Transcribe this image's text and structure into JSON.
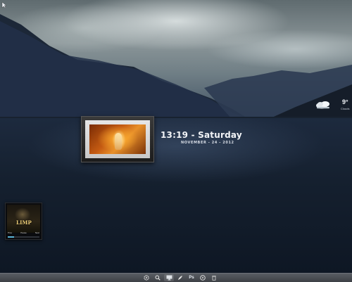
{
  "window": {
    "title": ""
  },
  "corner": {
    "icon": "arrow-cursor-icon"
  },
  "photo_widget": {
    "icon": "angel-photo"
  },
  "clock": {
    "time": "13:19",
    "separator": "-",
    "day": "Saturday",
    "date": "NOVEMBER - 24 - 2012"
  },
  "weather": {
    "temperature": "9°",
    "condition": "Clouds",
    "icon": "cloudy-weather-icon"
  },
  "media": {
    "album_title": "LIMP",
    "controls": [
      "Prev",
      "Pause",
      "Next"
    ],
    "progress": 0.2
  },
  "taskbar": {
    "items": [
      {
        "name": "settings",
        "icon": "gear-icon"
      },
      {
        "name": "search",
        "icon": "magnifier-icon"
      },
      {
        "name": "display",
        "icon": "monitor-icon"
      },
      {
        "name": "browser",
        "icon": "feather-icon"
      },
      {
        "name": "photoshop",
        "label": "Ps",
        "icon": "photoshop-icon"
      },
      {
        "name": "media",
        "icon": "disc-icon"
      },
      {
        "name": "trash",
        "icon": "trash-icon"
      }
    ]
  },
  "colors": {
    "accent": "#5bb6d8",
    "taskbar": "#4a4d52",
    "lake": "#15202f"
  }
}
